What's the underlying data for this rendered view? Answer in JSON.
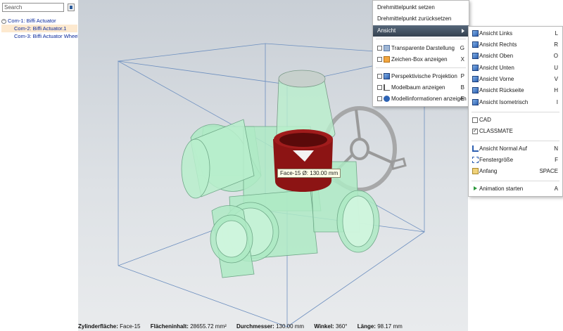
{
  "search": {
    "placeholder": "Search"
  },
  "tree": {
    "items": [
      {
        "label": "Com-1: Biffi Actuator",
        "toggle": "−"
      },
      {
        "label": "Com-2: Biffi Actuator.1"
      },
      {
        "label": "Com-3: Biffi Actuator Wheel.1"
      }
    ]
  },
  "tooltip": {
    "text": "Face-15 Ø: 130.00 mm"
  },
  "status": {
    "type_label": "Zylinderfläche:",
    "type_value": "Face-15",
    "area_label": "Flächeninhalt:",
    "area_value": "28655.72 mm²",
    "diameter_label": "Durchmesser:",
    "diameter_value": "130.00 mm",
    "angle_label": "Winkel:",
    "angle_value": "360°",
    "length_label": "Länge:",
    "length_value": "98.17 mm"
  },
  "context_menu": {
    "set_pivot": "Drehmittelpunkt setzen",
    "reset_pivot": "Drehmittelpunkt zurücksetzen",
    "view": "Ansicht",
    "transparent": {
      "label": "Transparente Darstellung",
      "shortcut": "G"
    },
    "drawing_box": {
      "label": "Zeichen-Box anzeigen",
      "shortcut": "X"
    },
    "perspective": {
      "label": "Perspektivische Projektion",
      "shortcut": "P"
    },
    "model_tree": {
      "label": "Modelbaum anzeigen",
      "shortcut": "B"
    },
    "model_info": {
      "label": "Modellinformationen anzeigen",
      "shortcut": "E"
    }
  },
  "view_submenu": {
    "left": {
      "label": "Ansicht Links",
      "shortcut": "L"
    },
    "right": {
      "label": "Ansicht Rechts",
      "shortcut": "R"
    },
    "top": {
      "label": "Ansicht Oben",
      "shortcut": "O"
    },
    "bottom": {
      "label": "Ansicht Unten",
      "shortcut": "U"
    },
    "front": {
      "label": "Ansicht Vorne",
      "shortcut": "V"
    },
    "back": {
      "label": "Ansicht Rückseite",
      "shortcut": "H"
    },
    "iso": {
      "label": "Ansicht Isometrisch",
      "shortcut": "I"
    },
    "cad": {
      "label": "CAD",
      "checked": false
    },
    "classmate": {
      "label": "CLASSMATE",
      "checked": true,
      "mark": "✓"
    },
    "normal": {
      "label": "Ansicht Normal Auf",
      "shortcut": "N"
    },
    "window": {
      "label": "Fenstergröße",
      "shortcut": "F"
    },
    "home": {
      "label": "Anfang",
      "shortcut": "SPACE"
    },
    "animation": {
      "label": "Animation starten",
      "shortcut": "A"
    }
  },
  "colors": {
    "highlight": "#3f4c5b",
    "selection": "#fde9cf",
    "model": "#9be0b6",
    "face": "#8c1414"
  }
}
